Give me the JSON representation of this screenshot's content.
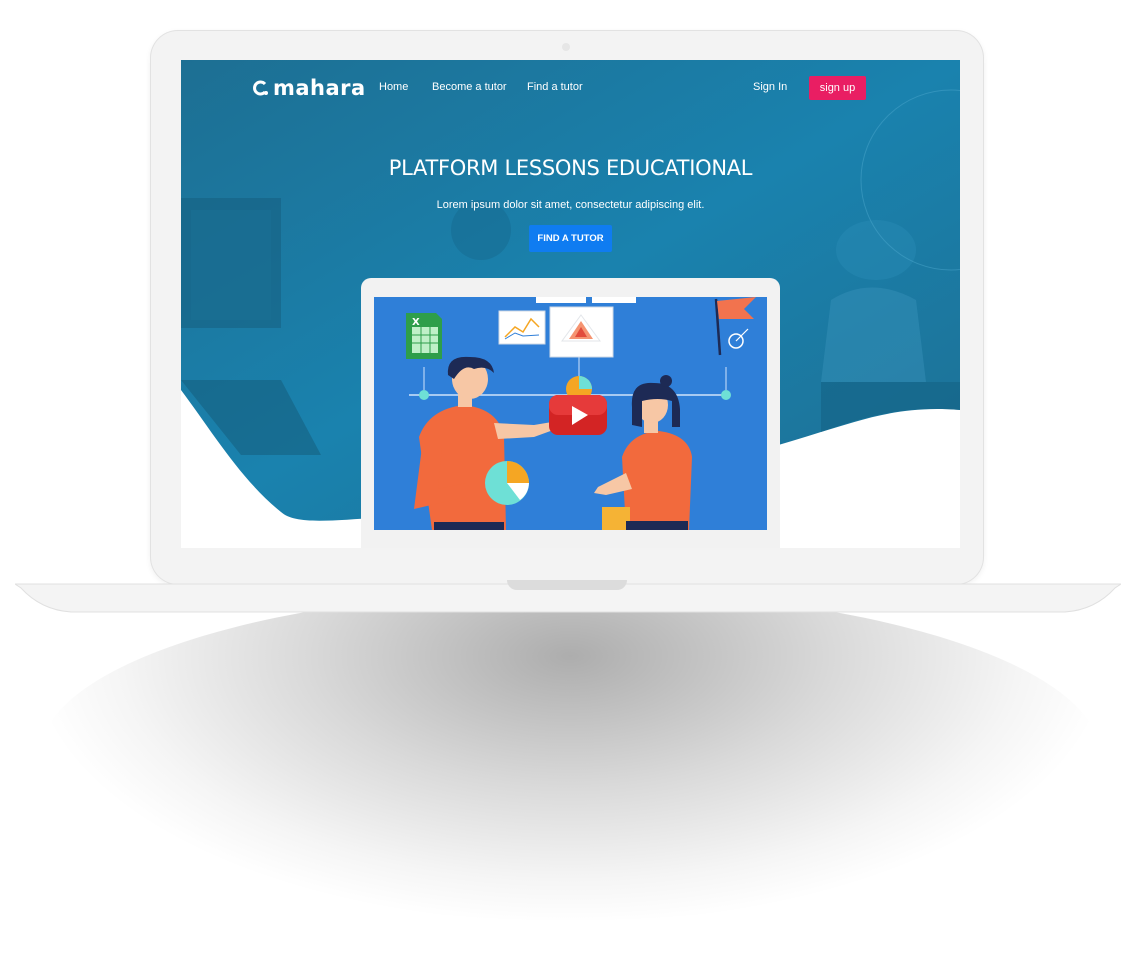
{
  "brand": {
    "name": "mahara"
  },
  "nav": {
    "links": [
      "Home",
      "Become a tutor",
      "Find a tutor"
    ],
    "sign_in": "Sign In",
    "sign_up": "sign up"
  },
  "hero": {
    "title": "PLATFORM LESSONS EDUCATIONAL",
    "subtitle": "Lorem ipsum dolor sit amet, consectetur adipiscing elit.",
    "cta": "FIND A TUTOR"
  },
  "illustration": {
    "icons": [
      "spreadsheet-icon",
      "line-chart-icon",
      "radar-chart-icon",
      "flag-icon",
      "target-icon",
      "play-button-icon",
      "pie-chart-icon"
    ]
  },
  "colors": {
    "hero_blue": "#1a7ca6",
    "accent_pink": "#e91e63",
    "cta_blue": "#0f7cf1",
    "illustration_blue": "#2f7fd8"
  }
}
